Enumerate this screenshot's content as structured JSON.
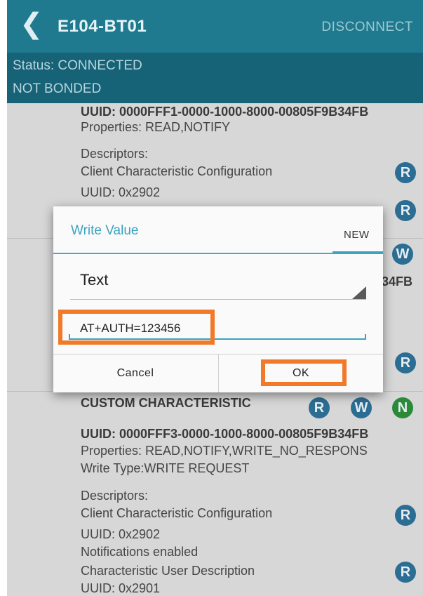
{
  "header": {
    "back_icon": "chevron-left-icon",
    "title": "E104-BT01",
    "disconnect_label": "DISCONNECT"
  },
  "status": {
    "connection": "Status: CONNECTED",
    "bonding": "NOT BONDED"
  },
  "background": {
    "char1": {
      "uuid": "UUID: 0000FFF1-0000-1000-8000-00805F9B34FB",
      "properties": "Properties: READ,NOTIFY",
      "descriptors_heading": "Descriptors:",
      "descriptor_name": "Client Characteristic Configuration",
      "descriptor_uuid": "UUID: 0x2902"
    },
    "peek_fragment": "34FB",
    "char3": {
      "title": "CUSTOM CHARACTERISTIC",
      "uuid": "UUID: 0000FFF3-0000-1000-8000-00805F9B34FB",
      "properties": "Properties: READ,NOTIFY,WRITE_NO_RESPONS",
      "write_type": "Write Type:WRITE REQUEST",
      "descriptors_heading": "Descriptors:",
      "descriptor1_name": "Client Characteristic Configuration",
      "descriptor1_uuid": "UUID: 0x2902",
      "descriptor1_status": "Notifications enabled",
      "descriptor2_name": "Characteristic User Description",
      "descriptor2_uuid": "UUID: 0x2901"
    },
    "badges": {
      "read": "R",
      "write": "W",
      "notify": "N"
    }
  },
  "dialog": {
    "title": "Write Value",
    "tab_label": "NEW",
    "format_selected": "Text",
    "input_value": "AT+AUTH=123456",
    "cancel_label": "Cancel",
    "ok_label": "OK"
  },
  "colors": {
    "app_bar": "#1f7a8f",
    "status_bar": "#166276",
    "accent": "#3aa3c0",
    "highlight": "#f07a2a",
    "badge_blue": "#2b6d93",
    "badge_green": "#2a8a3a"
  }
}
